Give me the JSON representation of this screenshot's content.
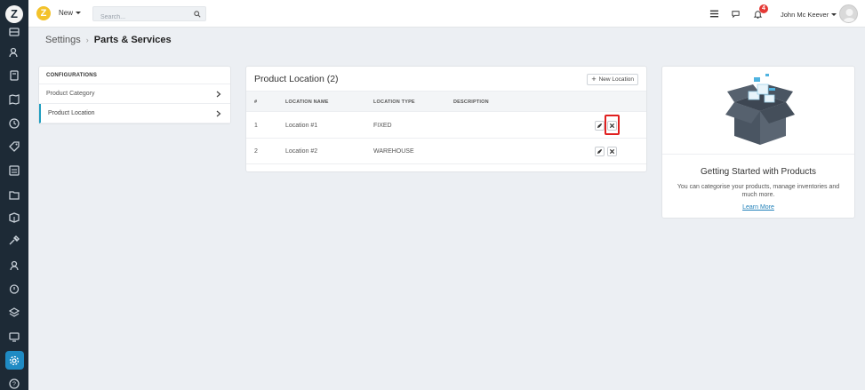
{
  "topbar": {
    "brand_letter": "Z",
    "new_label": "New",
    "search_placeholder": "Search...",
    "notification_count": "4",
    "user_name": "John Mc Keever"
  },
  "breadcrumb": {
    "parent": "Settings",
    "current": "Parts & Services"
  },
  "config": {
    "header": "CONFIGURATIONS",
    "items": [
      {
        "label": "Product Category",
        "active": false
      },
      {
        "label": "Product Location",
        "active": true
      }
    ]
  },
  "locations": {
    "title": "Product Location (2)",
    "new_button": "New Location",
    "columns": [
      "#",
      "LOCATION NAME",
      "LOCATION TYPE",
      "DESCRIPTION"
    ],
    "rows": [
      {
        "num": "1",
        "name": "Location #1",
        "type": "FIXED",
        "description": ""
      },
      {
        "num": "2",
        "name": "Location #2",
        "type": "WAREHOUSE",
        "description": ""
      }
    ]
  },
  "getting_started": {
    "title": "Getting Started with Products",
    "description": "You can categorise your products, manage inventories and much more.",
    "link": "Learn More"
  },
  "colors": {
    "rail": "#1d2a36",
    "accent": "#1f8bc4",
    "highlight": "#e02020",
    "badge": "#e53935"
  }
}
